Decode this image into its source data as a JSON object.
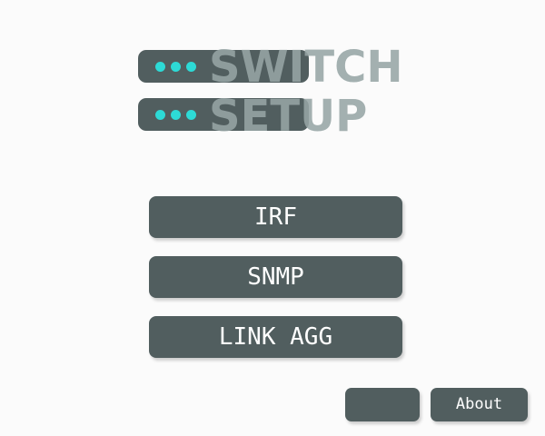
{
  "logo": {
    "title_line1": "SWITCH",
    "title_line2": "SETUP",
    "icon": "server-rack-icon",
    "accent_color": "#2ddad6",
    "bar_color": "#515e5f"
  },
  "menu": {
    "irf_label": "IRF",
    "snmp_label": "SNMP",
    "link_agg_label": "LINK AGG"
  },
  "footer": {
    "blank_label": "",
    "about_label": "About"
  }
}
